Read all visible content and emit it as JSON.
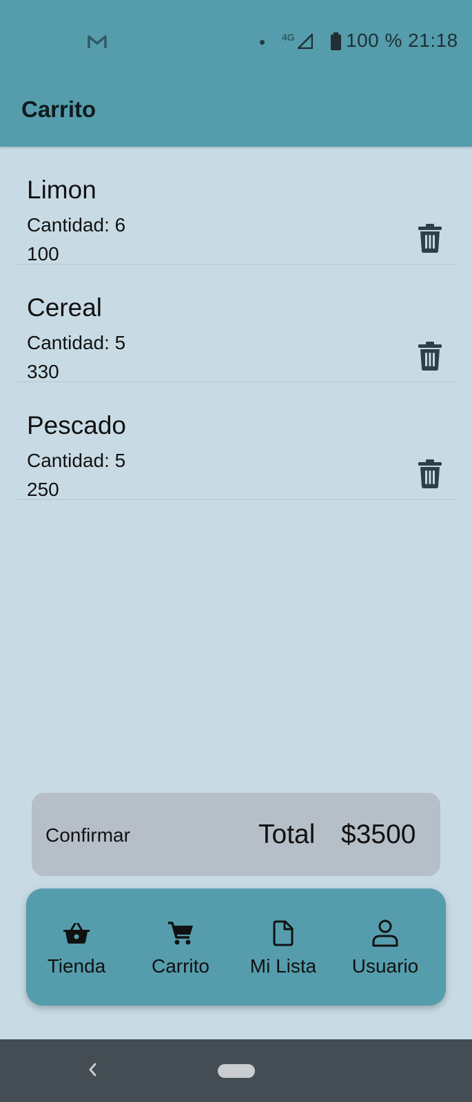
{
  "status_bar": {
    "network": "4G",
    "battery_time": "100 % 21:18",
    "icons": [
      "gmail-icon",
      "notification-dot-icon",
      "signal-icon",
      "battery-icon"
    ]
  },
  "app_bar": {
    "title": "Carrito"
  },
  "cart": {
    "items": [
      {
        "name": "Limon",
        "quantity": "Cantidad: 6",
        "price": "100",
        "action_icon": "trash-icon"
      },
      {
        "name": "Cereal",
        "quantity": "Cantidad: 5",
        "price": "330",
        "action_icon": "trash-icon"
      },
      {
        "name": "Pescado",
        "quantity": "Cantidad: 5",
        "price": "250",
        "action_icon": "trash-icon"
      }
    ]
  },
  "summary": {
    "confirm_label": "Confirmar",
    "total_label": "Total",
    "total_value": "$3500"
  },
  "bottom_nav": {
    "items": [
      {
        "label": "Tienda",
        "icon": "basket-icon"
      },
      {
        "label": "Carrito",
        "icon": "cart-icon"
      },
      {
        "label": "Mi Lista",
        "icon": "document-icon"
      },
      {
        "label": "Usuario",
        "icon": "user-icon"
      }
    ]
  },
  "system_nav": {
    "icons": [
      "back-icon",
      "home-pill-icon"
    ]
  },
  "colors": {
    "primary": "#559dac",
    "background": "#c8dbe5",
    "summary_bar": "#b6bec8",
    "icon_dark": "#2f3f4a",
    "system_nav": "#434d53"
  }
}
